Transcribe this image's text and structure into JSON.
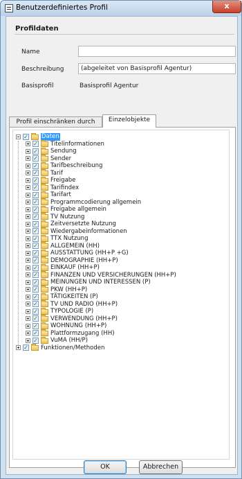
{
  "window": {
    "title": "Benutzerdefiniertes Profil",
    "close_glyph": "x"
  },
  "profildaten": {
    "section_title": "Profildaten",
    "name_label": "Name",
    "name_value": "",
    "beschreibung_label": "Beschreibung",
    "beschreibung_value": "(abgeleitet von Basisprofil Agentur)",
    "basisprofil_label": "Basisprofil",
    "basisprofil_value": "Basisprofil Agentur"
  },
  "tabs": [
    {
      "label": "Profil einschränken durch",
      "active": false
    },
    {
      "label": "Einzelobjekte",
      "active": true
    }
  ],
  "tree": {
    "root_label": "Daten",
    "children": [
      "Titelinformationen",
      "Sendung",
      "Sender",
      "Tarifbeschreibung",
      "Tarif",
      "Freigabe",
      "Tarifindex",
      "Tarifart",
      "Programmcodierung allgemein",
      "Freigabe allgemein",
      "TV Nutzung",
      "Zeitversetzte Nutzung",
      "Wiedergabeinformationen",
      "TTX Nutzung",
      "ALLGEMEIN (HH)",
      "AUSSTATTUNG (HH+P +G)",
      "DEMOGRAPHIE (HH+P)",
      "EINKAUF (HH+P)",
      "FINANZEN UND VERSICHERUNGEN (HH+P)",
      "MEINUNGEN UND INTERESSEN (P)",
      "PKW (HH+P)",
      "TÄTIGKEITEN (P)",
      "TV UND RADIO (HH+P)",
      "TYPOLOGIE (P)",
      "VERWENDUNG (HH+P)",
      "WOHNUNG (HH+P)",
      "Plattformzugang (HH)",
      "VuMA (HH/P)"
    ],
    "second_root_label": "Funktionen/Methoden",
    "check_glyph": "✓"
  },
  "buttons": {
    "ok_label": "OK",
    "cancel_label": "Abbrechen"
  }
}
